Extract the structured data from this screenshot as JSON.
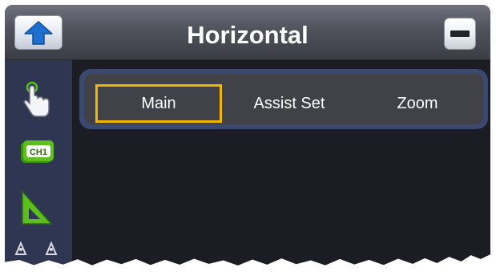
{
  "window": {
    "title": "Horizontal"
  },
  "sidebar": {
    "items": [
      {
        "icon": "touch-hand-icon"
      },
      {
        "icon": "channel-icon",
        "label": "CH1"
      },
      {
        "icon": "ruler-triangle-icon"
      },
      {
        "icon": "probe-icon"
      }
    ]
  },
  "tabs": [
    {
      "label": "Main",
      "selected": true
    },
    {
      "label": "Assist Set",
      "selected": false
    },
    {
      "label": "Zoom",
      "selected": false
    }
  ],
  "colors": {
    "selection_border": "#f2b705",
    "panel_background": "#1c1d24",
    "sidebar_background": "#2f3651",
    "tab_frame": "#3b4870",
    "arrow_blue": "#1f6fcf",
    "icon_green": "#5cbf1e"
  }
}
